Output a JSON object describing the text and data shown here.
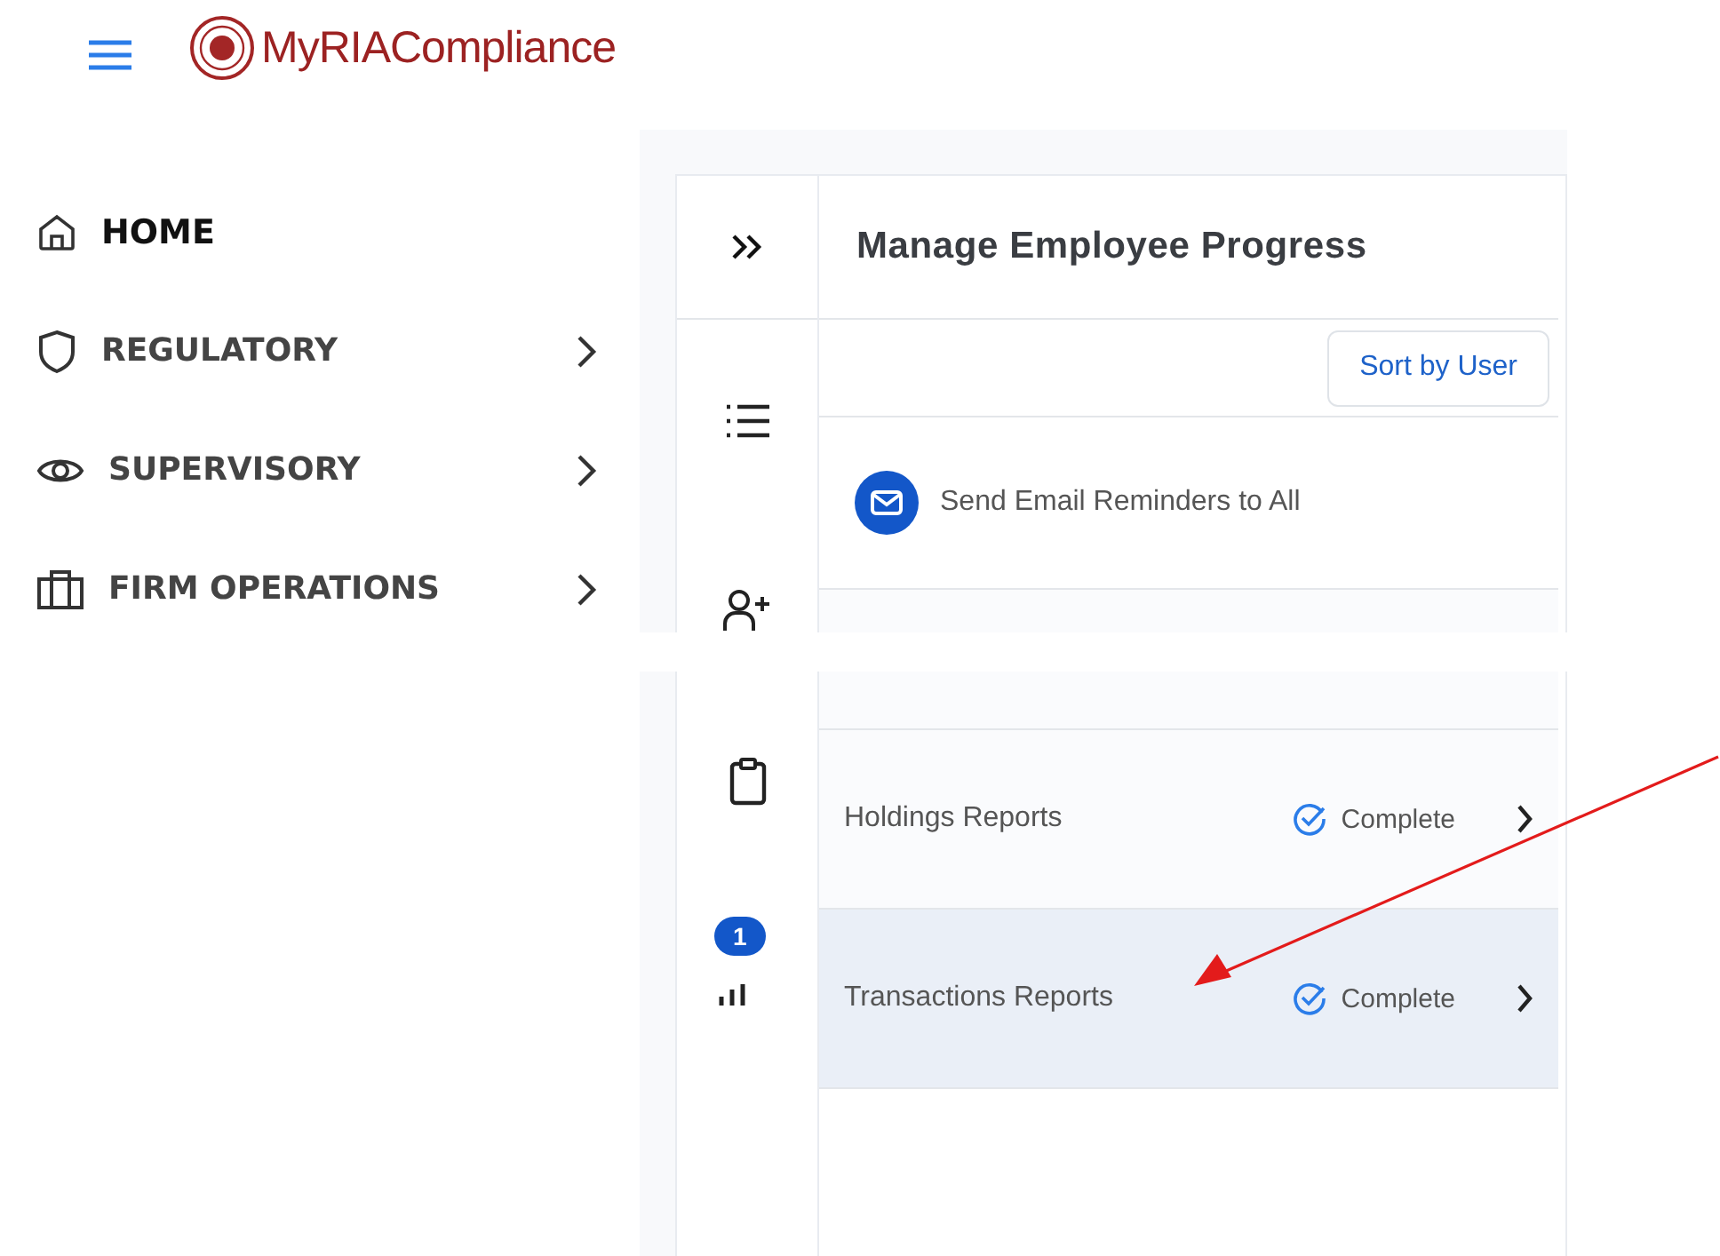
{
  "header": {
    "logo_text": "MyRIACompliance"
  },
  "nav": [
    {
      "label": "HOME",
      "kind": "home",
      "expandable": false,
      "selected": true
    },
    {
      "label": "REGULATORY",
      "kind": "shield",
      "expandable": true,
      "selected": false
    },
    {
      "label": "SUPERVISORY",
      "kind": "eye",
      "expandable": true,
      "selected": false
    },
    {
      "label": "FIRM OPERATIONS",
      "kind": "briefcase",
      "expandable": true,
      "selected": false
    }
  ],
  "panel": {
    "title": "Manage Employee Progress",
    "sort_button": "Sort by User",
    "email_action": "Send Email Reminders to All",
    "reports": [
      {
        "name": "Holdings Reports",
        "status": "Complete",
        "selected": false
      },
      {
        "name": "Transactions Reports",
        "status": "Complete",
        "selected": true
      }
    ],
    "badge": "1"
  }
}
